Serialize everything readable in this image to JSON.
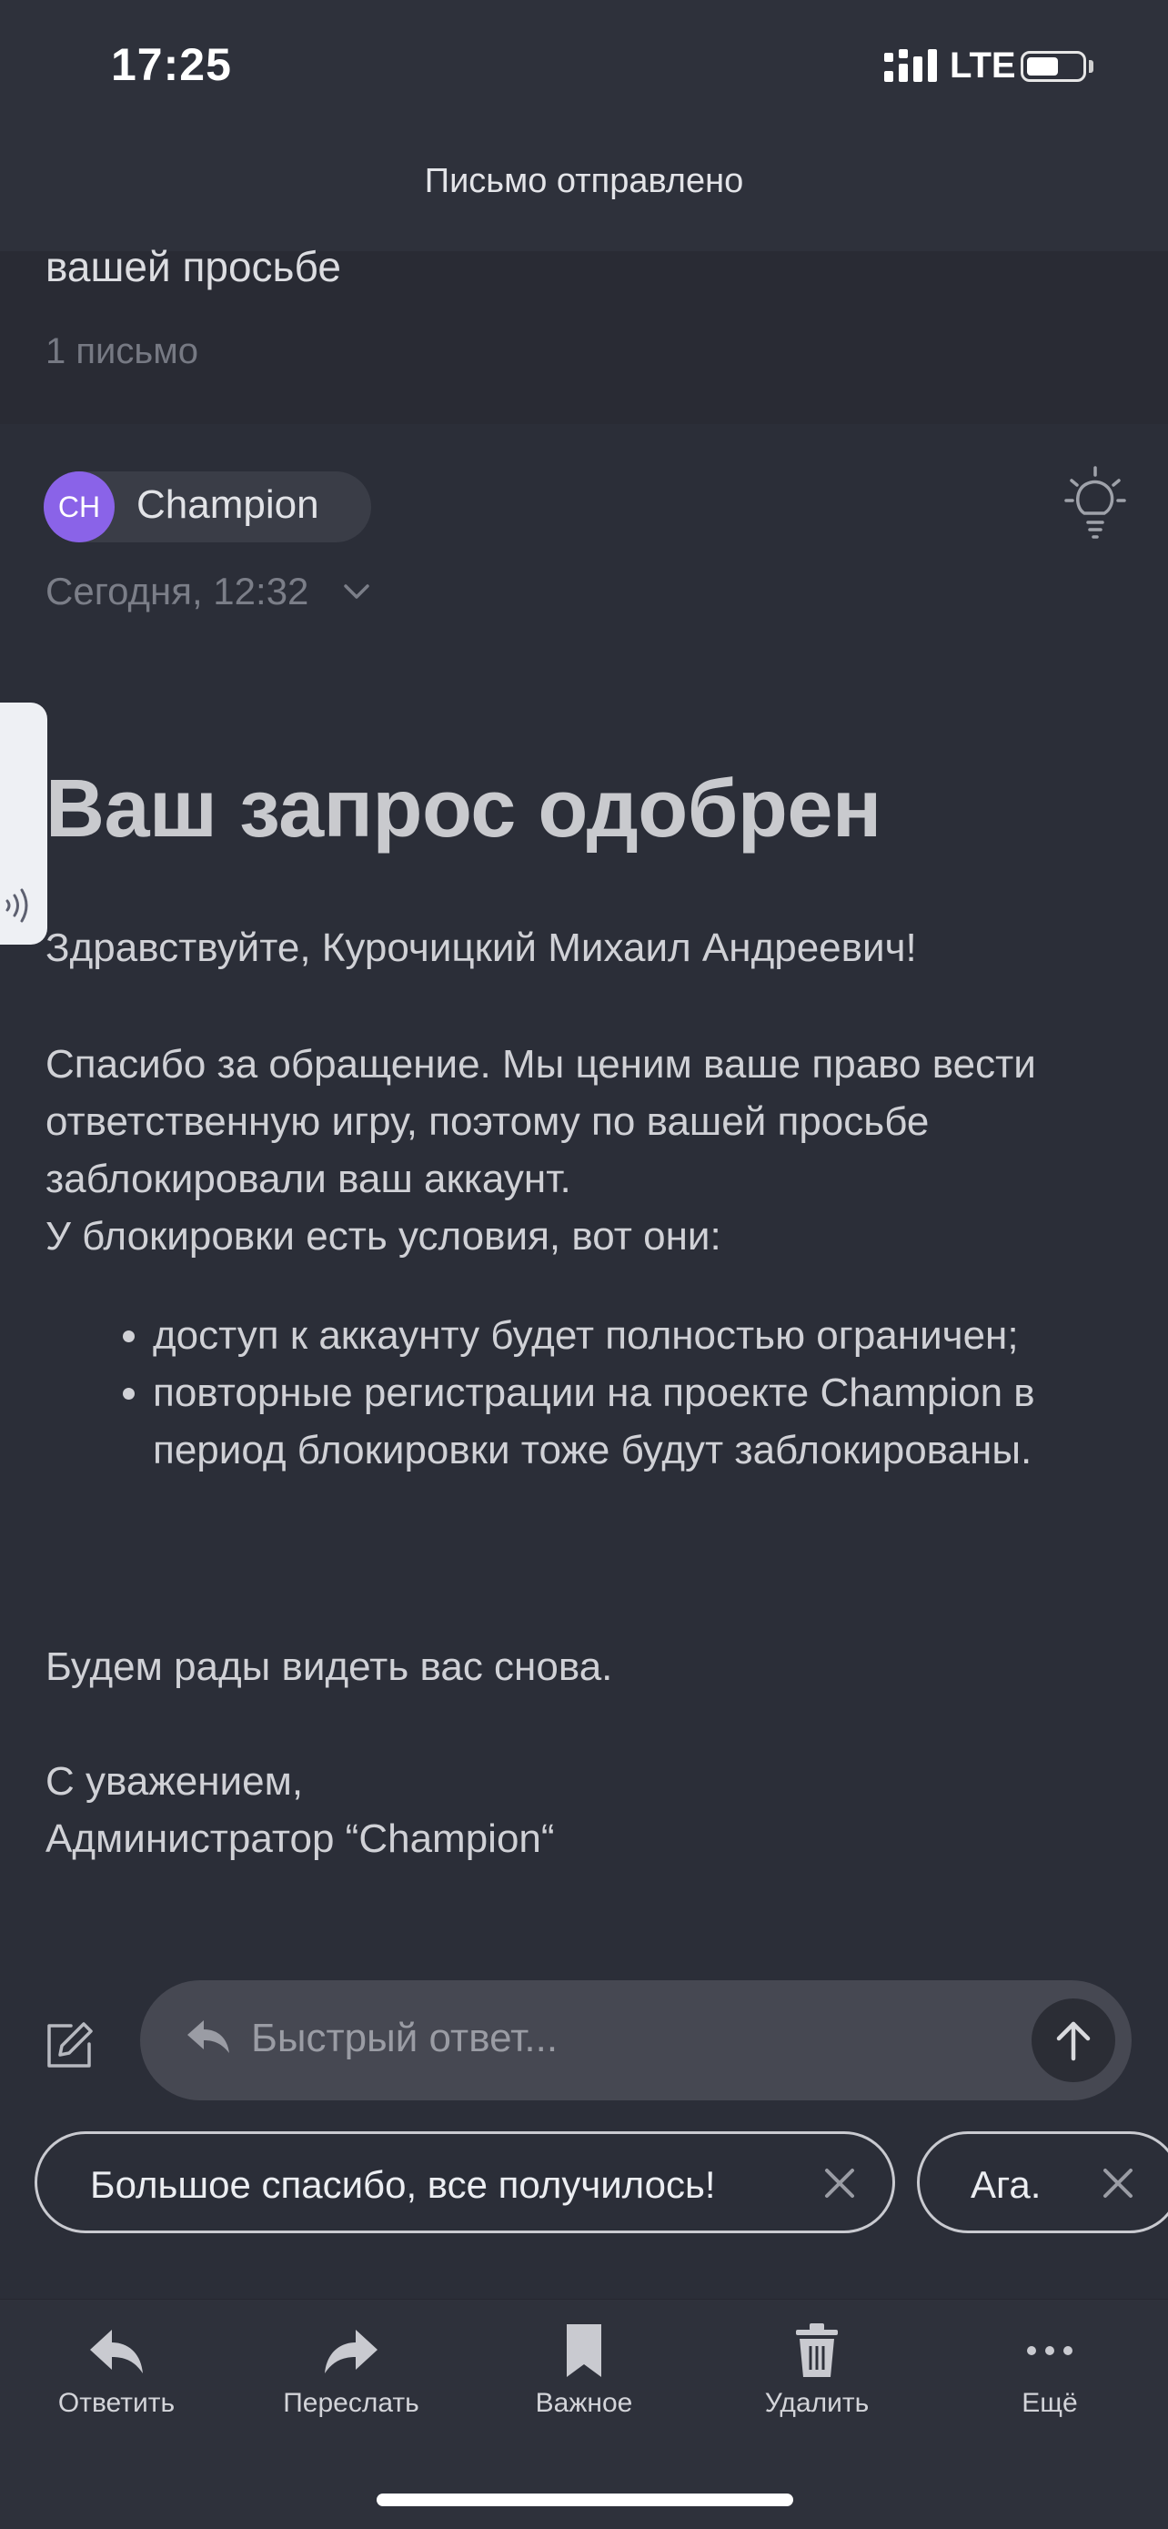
{
  "status_bar": {
    "time": "17:25",
    "network": "LTE"
  },
  "header": {
    "title": "Письмо отправлено"
  },
  "thread": {
    "subject_tail": "вашей просьбе",
    "count": "1 письмо"
  },
  "sender": {
    "initials": "CH",
    "name": "Champion",
    "date": "Сегодня, 12:32"
  },
  "message": {
    "heading": "Ваш запрос одобрен",
    "greeting": "Здравствуйте, Курочицкий Михаил Андреевич!",
    "p1": "Спасибо за обращение. Мы ценим ваше право вести ответственную игру, поэтому по вашей просьбе заблокировали ваш аккаунт.",
    "p1b": "У блокировки есть условия, вот они:",
    "conditions": [
      "доступ к аккаунту будет полностью ограничен;",
      "повторные регистрации на проекте Champion в период блокировки тоже будут заблокированы."
    ],
    "closing": "Будем рады видеть вас снова.",
    "regards": "С уважением,",
    "signature": "Администратор “Champion“"
  },
  "quick_reply": {
    "placeholder": "Быстрый ответ...",
    "suggestions": [
      "Большое спасибо, все получилось!",
      "Ага."
    ]
  },
  "toolbar": {
    "reply": "Ответить",
    "forward": "Переслать",
    "important": "Важное",
    "delete": "Удалить",
    "more": "Ещё"
  },
  "colors": {
    "avatar": "#8a63e8",
    "background": "#2b2e38"
  }
}
